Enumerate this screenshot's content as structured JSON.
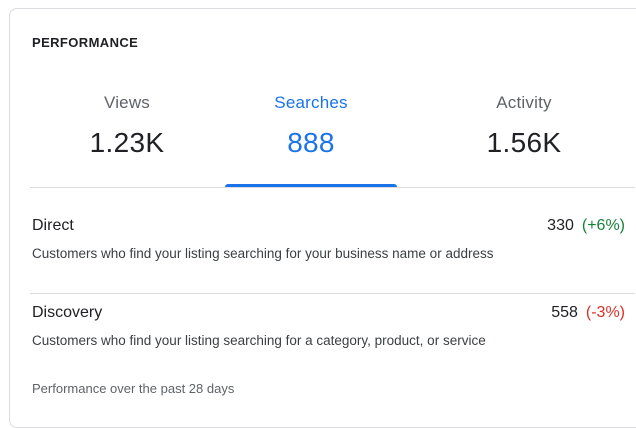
{
  "card": {
    "title": "PERFORMANCE"
  },
  "tabs": [
    {
      "label": "Views",
      "value": "1.23K",
      "active": false
    },
    {
      "label": "Searches",
      "value": "888",
      "active": true
    },
    {
      "label": "Activity",
      "value": "1.56K",
      "active": false
    }
  ],
  "breakdown": [
    {
      "name": "Direct",
      "count": "330",
      "change": "(+6%)",
      "change_direction": "up",
      "description": "Customers who find your listing searching for your business name or address"
    },
    {
      "name": "Discovery",
      "count": "558",
      "change": "(-3%)",
      "change_direction": "down",
      "description": "Customers who find your listing searching for a category, product, or service"
    }
  ],
  "footer": {
    "note": "Performance over the past 28 days"
  },
  "colors": {
    "accent": "#1a73e8",
    "positive": "#188038",
    "negative": "#d93025",
    "border": "#dadce0",
    "muted_text": "#5f6368"
  }
}
